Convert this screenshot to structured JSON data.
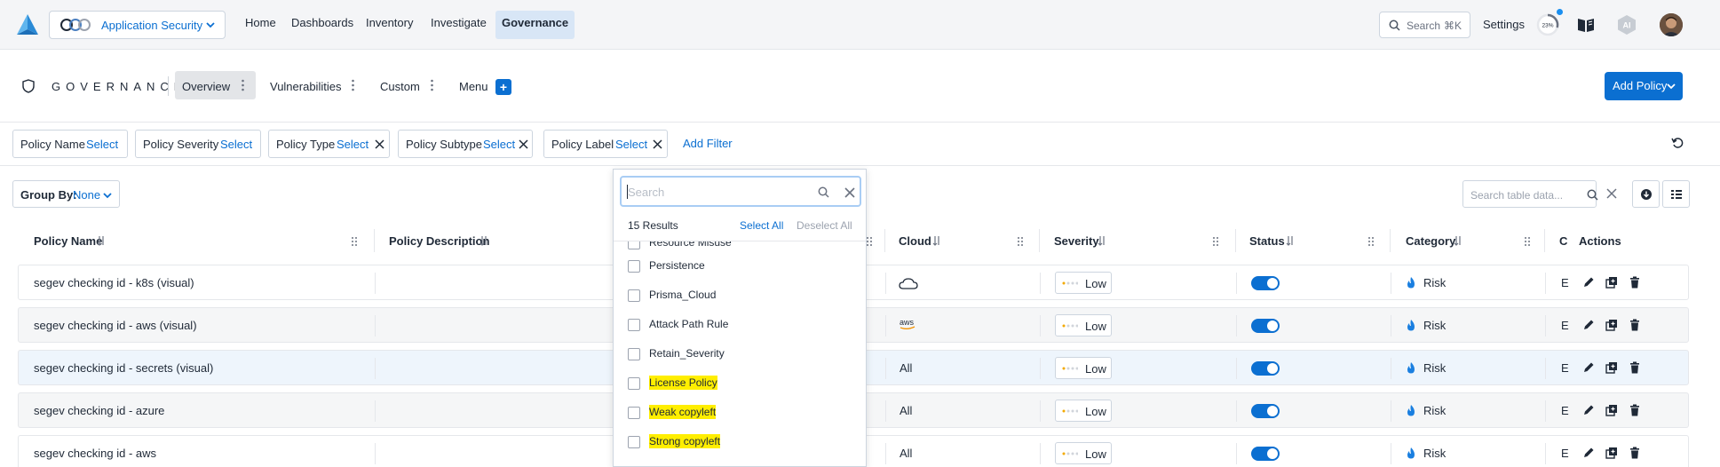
{
  "topnav": {
    "app_name": "Application Security",
    "items": [
      "Home",
      "Dashboards",
      "Inventory",
      "Investigate",
      "Governance"
    ],
    "active_item": "Governance",
    "search_label": "Search",
    "search_shortcut": "⌘K",
    "settings_label": "Settings",
    "usage_percent": "23%"
  },
  "page": {
    "title": "GOVERNANCE",
    "tabs": [
      "Overview",
      "Vulnerabilities",
      "Custom",
      "Menu"
    ],
    "active_tab": "Overview",
    "add_policy_label": "Add Policy"
  },
  "filters": [
    {
      "name": "Policy Name",
      "value": "Select",
      "removable": false
    },
    {
      "name": "Policy Severity",
      "value": "Select",
      "removable": false
    },
    {
      "name": "Policy Type",
      "value": "Select",
      "removable": true
    },
    {
      "name": "Policy Subtype",
      "value": "Select",
      "removable": true
    },
    {
      "name": "Policy Label",
      "value": "Select",
      "removable": true
    }
  ],
  "add_filter_label": "Add Filter",
  "group_by": {
    "label": "Group By:",
    "value": "None"
  },
  "table_search_placeholder": "Search table data...",
  "columns": [
    "Policy Name",
    "Policy Description",
    "Cloud",
    "Severity",
    "Status",
    "Category",
    "C",
    "Actions"
  ],
  "rows": [
    {
      "name": "segev checking id - k8s (visual)",
      "cloud": "",
      "cloud_icon": "cloud-icon",
      "severity": "Low",
      "status": true,
      "category": "Risk",
      "c": "E"
    },
    {
      "name": "segev checking id - aws (visual)",
      "cloud": "aws",
      "cloud_icon": "aws-icon",
      "severity": "Low",
      "status": true,
      "category": "Risk",
      "c": "E"
    },
    {
      "name": "segev checking id - secrets (visual)",
      "cloud": "All",
      "cloud_icon": "",
      "severity": "Low",
      "status": true,
      "category": "Risk",
      "c": "E"
    },
    {
      "name": "segev checking id - azure",
      "cloud": "All",
      "cloud_icon": "",
      "severity": "Low",
      "status": true,
      "category": "Risk",
      "c": "E"
    },
    {
      "name": "segev checking id - aws",
      "cloud": "All",
      "cloud_icon": "",
      "severity": "Low",
      "status": true,
      "category": "Risk",
      "c": "E"
    }
  ],
  "dropdown": {
    "search_placeholder": "Search",
    "results_count": "15 Results",
    "select_all": "Select All",
    "deselect_all": "Deselect All",
    "options": [
      {
        "label": "Resource Misuse",
        "highlight": false
      },
      {
        "label": "Persistence",
        "highlight": false
      },
      {
        "label": "Prisma_Cloud",
        "highlight": false
      },
      {
        "label": "Attack Path Rule",
        "highlight": false
      },
      {
        "label": "Retain_Severity",
        "highlight": false
      },
      {
        "label": "License Policy",
        "highlight": true
      },
      {
        "label": "Weak copyleft",
        "highlight": true
      },
      {
        "label": "Strong copyleft",
        "highlight": true
      }
    ]
  },
  "colors": {
    "accent": "#0b6fd1",
    "highlight": "#ffee00",
    "nav_bg": "#f4f5f7"
  }
}
